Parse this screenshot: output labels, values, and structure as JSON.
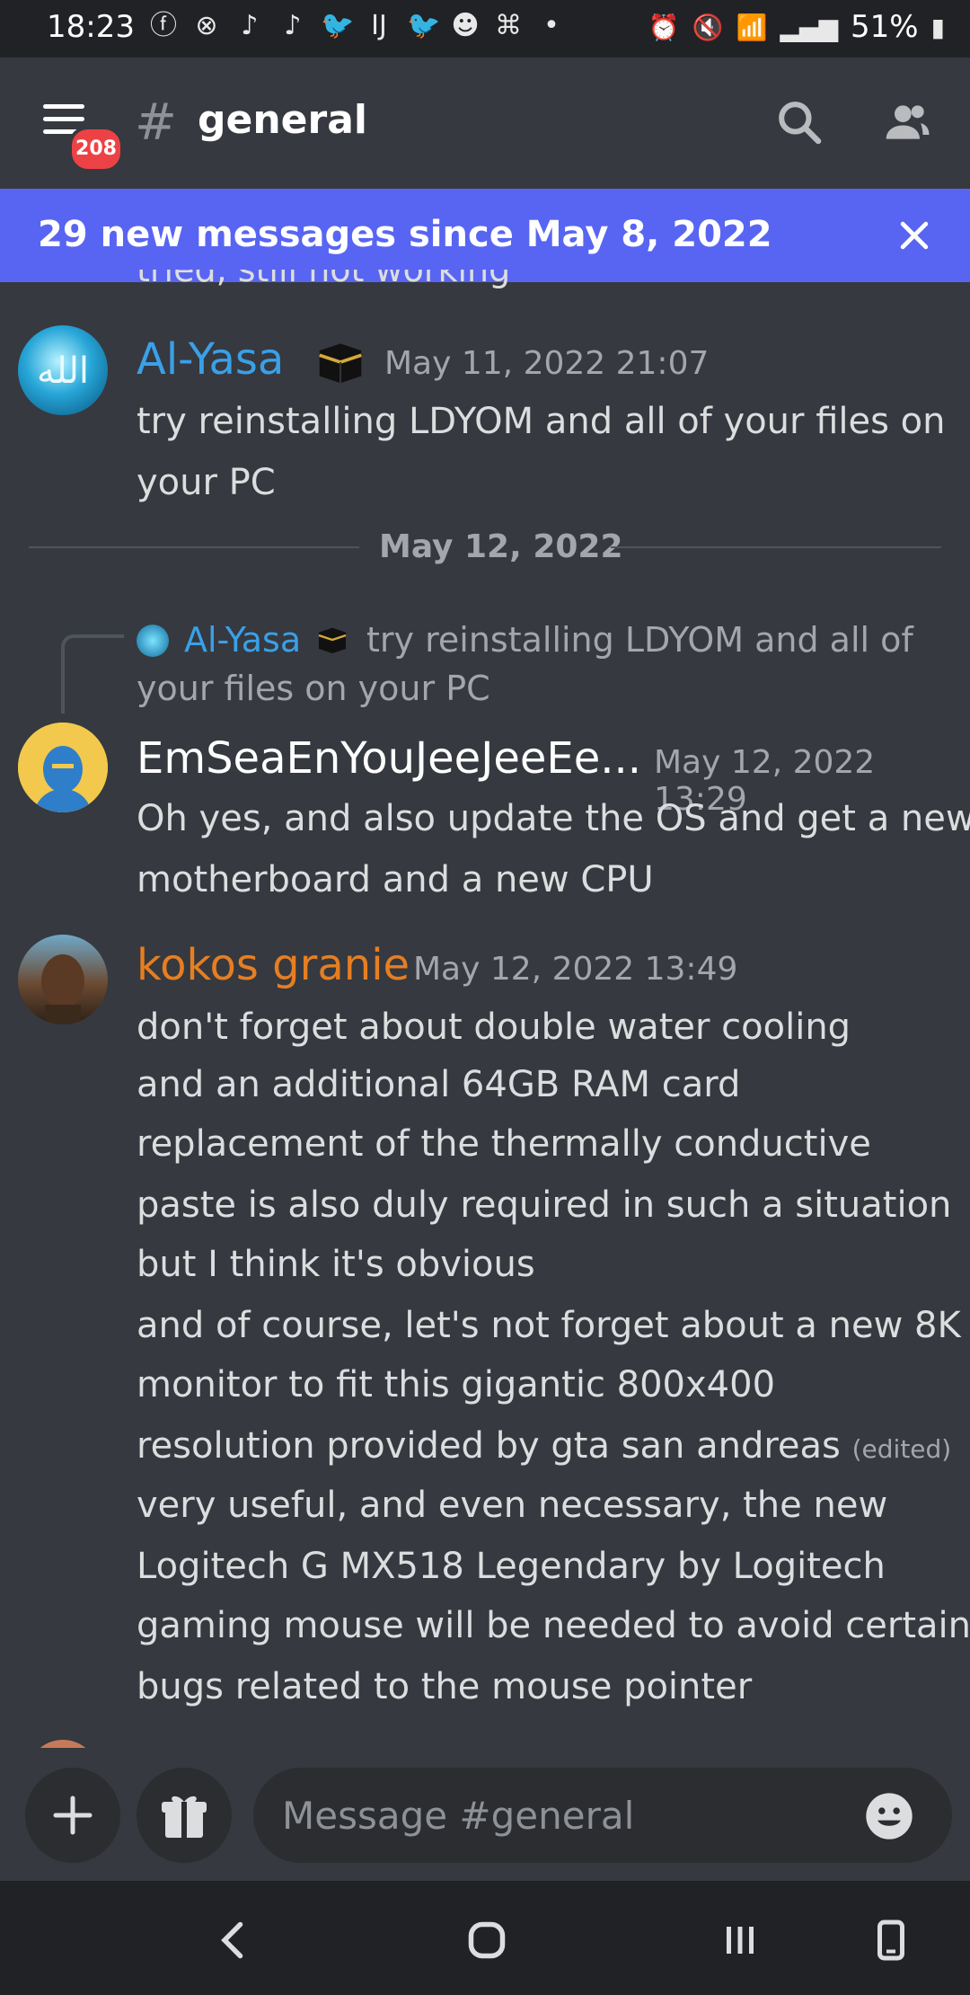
{
  "status_bar": {
    "time": "18:23",
    "battery": "51%",
    "notification_icons": [
      "facebook-icon",
      "x-icon",
      "tiktok-icon",
      "tiktok-icon",
      "twitter-icon",
      "app-icon",
      "twitter-icon",
      "reddit-icon",
      "app-icon",
      "dot-icon"
    ]
  },
  "header": {
    "channel_name": "general",
    "unread_badge": "208"
  },
  "banner": {
    "text": "29 new messages since May 8, 2022"
  },
  "messages": {
    "partial_text": "tried, still not working",
    "m1": {
      "author": "Al-Yasa",
      "author_color": "#3aa0e8",
      "timestamp": "May 11, 2022 21:07",
      "lines": [
        "try reinstalling LDYOM and all of your files on",
        "your PC"
      ]
    },
    "divider_date": "May 12, 2022",
    "m2": {
      "reply_author": "Al-Yasa",
      "reply_text_line1": "try reinstalling LDYOM and all of",
      "reply_text_line2": "your files on your PC",
      "author": "EmSeaEnYouJeeJeeEe...",
      "author_color": "#ffffff",
      "timestamp": "May 12, 2022 13:29",
      "lines": [
        "Oh yes, and also update the OS and get a new",
        "motherboard and a new CPU"
      ]
    },
    "m3": {
      "author": "kokos granie",
      "author_color": "#e67e22",
      "timestamp": "May 12, 2022 13:49",
      "lines": [
        "don't forget about double water cooling",
        "and an additional 64GB RAM card",
        "replacement of the thermally conductive",
        "paste is also duly required in such a situation",
        "but I think it's obvious",
        "and of course, let's not forget about a new 8K",
        "monitor to fit this gigantic 800x400",
        "resolution provided by gta san andreas",
        "very useful, and even necessary, the new",
        "Logitech G MX518 Legendary by Logitech",
        "gaming mouse will be needed to avoid certain",
        "bugs related to the mouse pointer"
      ],
      "edited_label": "(edited)"
    }
  },
  "composer": {
    "placeholder": "Message #general"
  },
  "colors": {
    "background": "#36393f",
    "banner": "#5865f2",
    "badge": "#ed4245"
  }
}
